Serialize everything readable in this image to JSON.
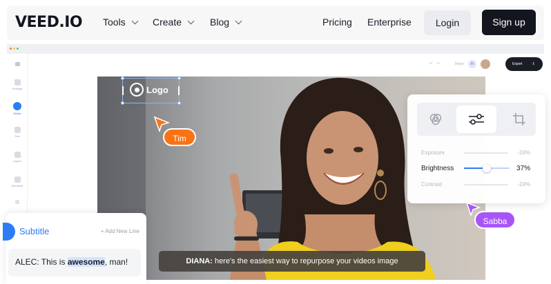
{
  "nav": {
    "logo": "VEED.IO",
    "menus": [
      {
        "label": "Tools"
      },
      {
        "label": "Create"
      },
      {
        "label": "Blog"
      }
    ],
    "links": [
      "Pricing",
      "Enterprise"
    ],
    "login": "Login",
    "signup": "Sign up"
  },
  "editor": {
    "sidebar": [
      "Settings",
      "Media",
      "Text",
      "Layers",
      "Elements"
    ],
    "toolbar": {
      "share": "Share",
      "avatar_initials": "M"
    },
    "export": "Export",
    "logo_element": "Logo",
    "cursors": [
      {
        "name": "Tim",
        "color": "#f97316"
      },
      {
        "name": "Sabba",
        "color": "#a855f7"
      }
    ],
    "adjust": {
      "rows": [
        {
          "label": "Exposure",
          "value": "-24%"
        },
        {
          "label": "Brightness",
          "value": "37%",
          "level": 0.5
        },
        {
          "label": "Contrast",
          "value": "-24%"
        }
      ]
    },
    "subtitle": {
      "title": "Subtitle",
      "add_line": "+ Add New Line",
      "line_prefix": "ALEC: This is ",
      "line_highlight": "awesome",
      "line_suffix": ", man!"
    },
    "caption": {
      "speaker": "DIANA:",
      "text": " here's the easiest way to repurpose your videos image"
    }
  },
  "colors": {
    "accent": "#2d7cf6",
    "dark": "#14161f",
    "tim": "#f97316",
    "sabba": "#a855f7",
    "dress": "#f0cf1e"
  }
}
